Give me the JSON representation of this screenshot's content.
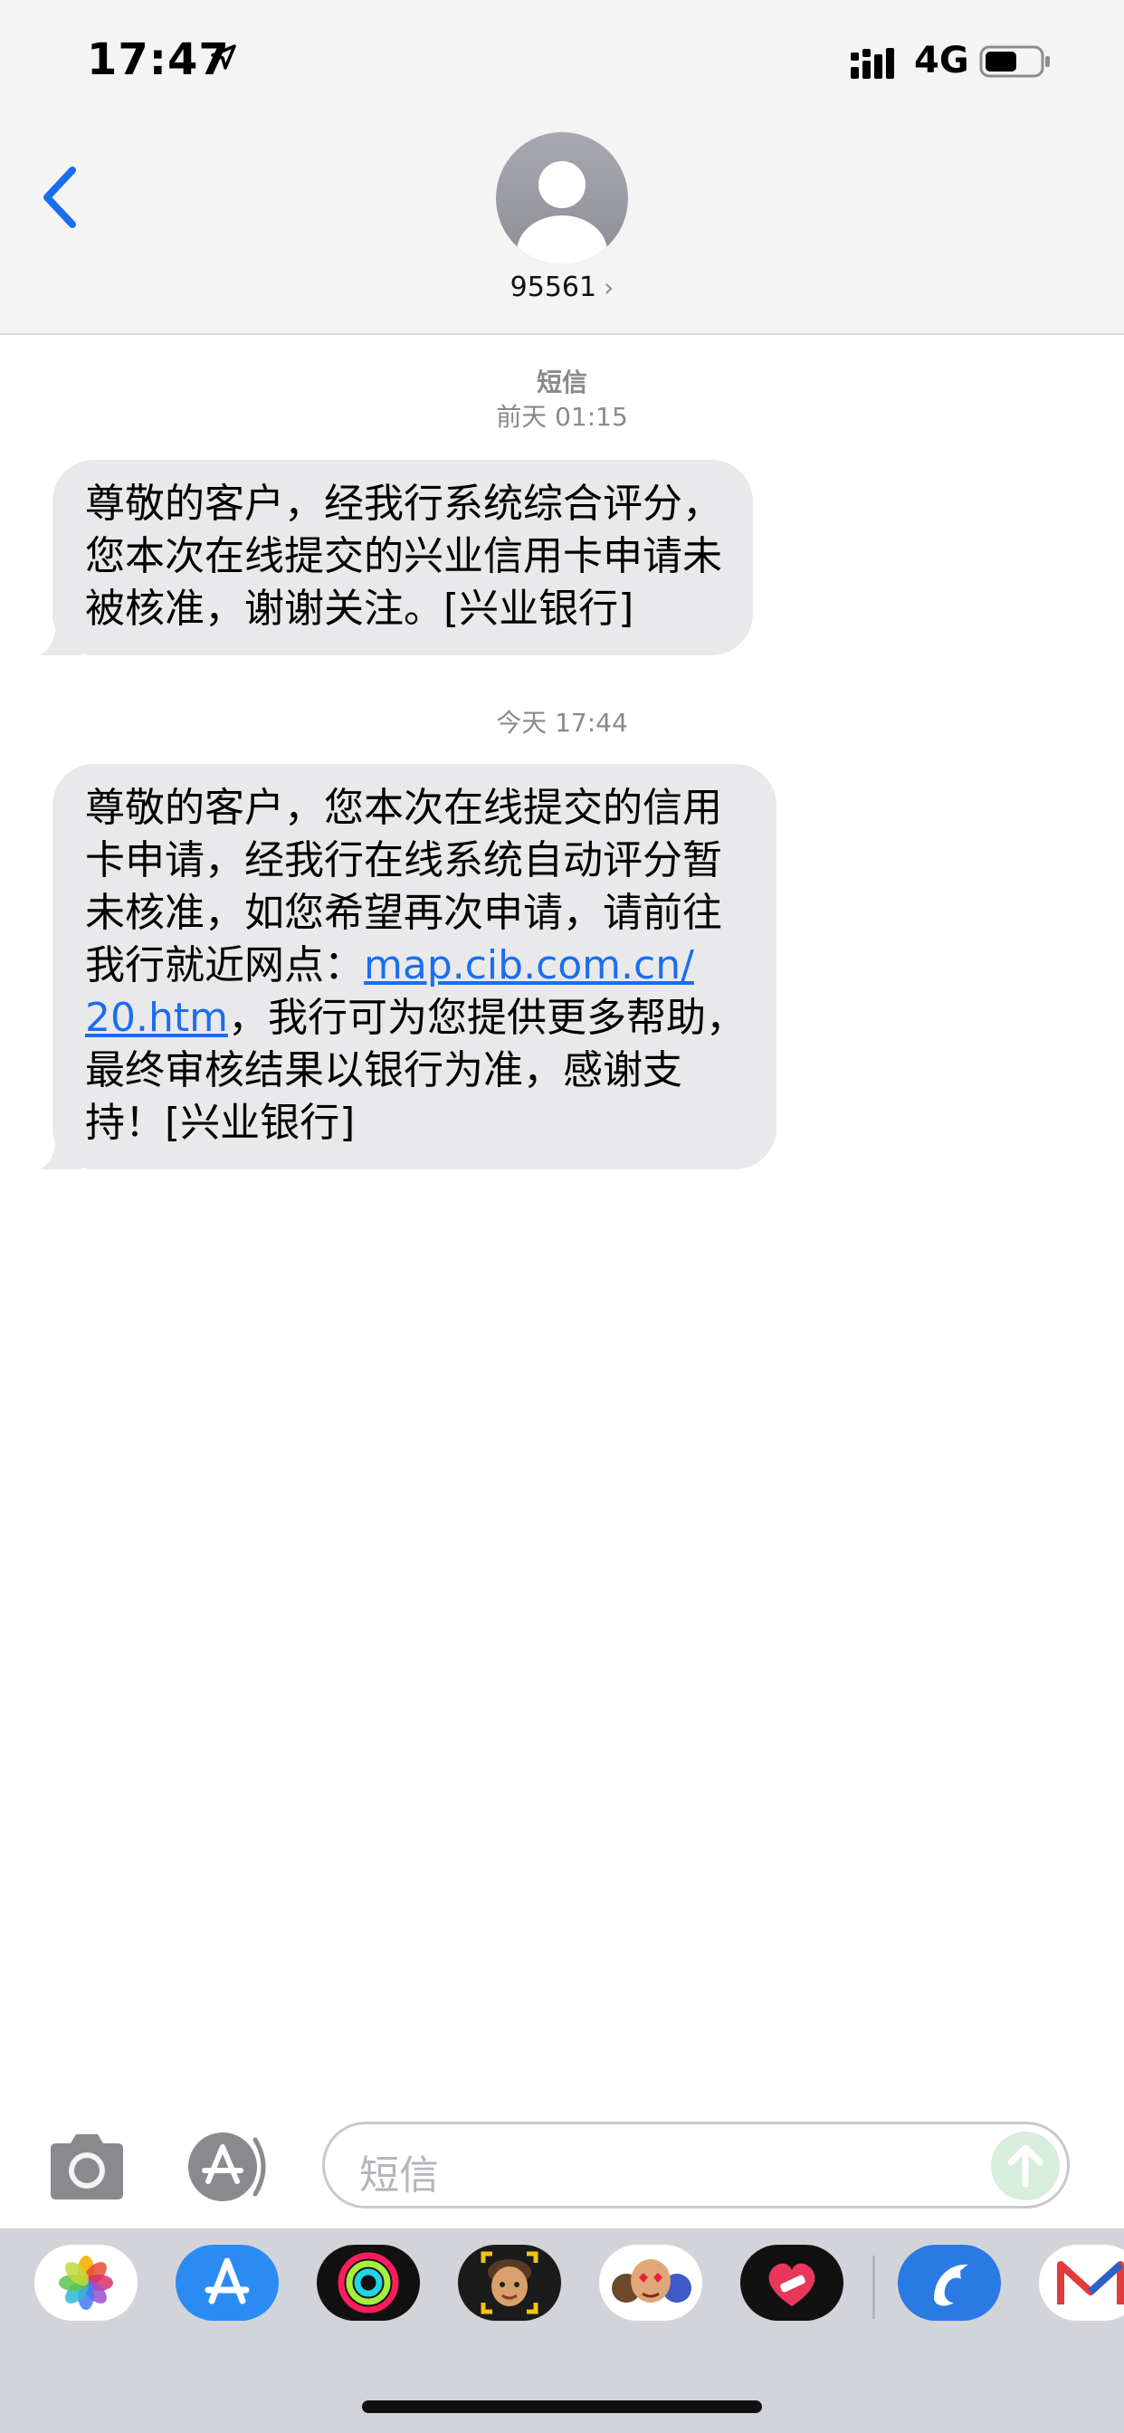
{
  "status_bar": {
    "time": "17:47",
    "network": "4G"
  },
  "header": {
    "contact": "95561"
  },
  "conversation": {
    "groups": [
      {
        "service": "短信",
        "timestamp": "前天 01:15",
        "lines": [
          "尊敬的客户，经我行系统综合评分，",
          "您本次在线提交的兴业信用卡申请未",
          "被核准，谢谢关注。[兴业银行]"
        ]
      },
      {
        "timestamp": "今天 17:44",
        "lines": [
          "尊敬的客户，您本次在线提交的信用",
          "卡申请，经我行在线系统自动评分暂",
          "未核准，如您希望再次申请，请前往",
          "我行就近网点："
        ],
        "link_part1": "map.cib.com.cn/",
        "link_part2": "20.htm",
        "after_link": "，我行可为您提供更多帮助，",
        "lines_end": [
          "最终审核结果以银行为准，感谢支",
          "持！[兴业银行]"
        ]
      }
    ]
  },
  "input": {
    "placeholder": "短信"
  },
  "app_drawer": {
    "apps": [
      "photos-icon",
      "app-store-icon",
      "activity-icon",
      "memoji-icon",
      "animoji-icon",
      "heart-sticker-icon",
      "dolphin-app-icon",
      "mail-app-icon"
    ]
  },
  "colors": {
    "accent": "#1a6ef0",
    "bubble": "#e9e9eb",
    "header_bg": "#f4f4f4",
    "drawer_bg": "#d3d4d9"
  }
}
